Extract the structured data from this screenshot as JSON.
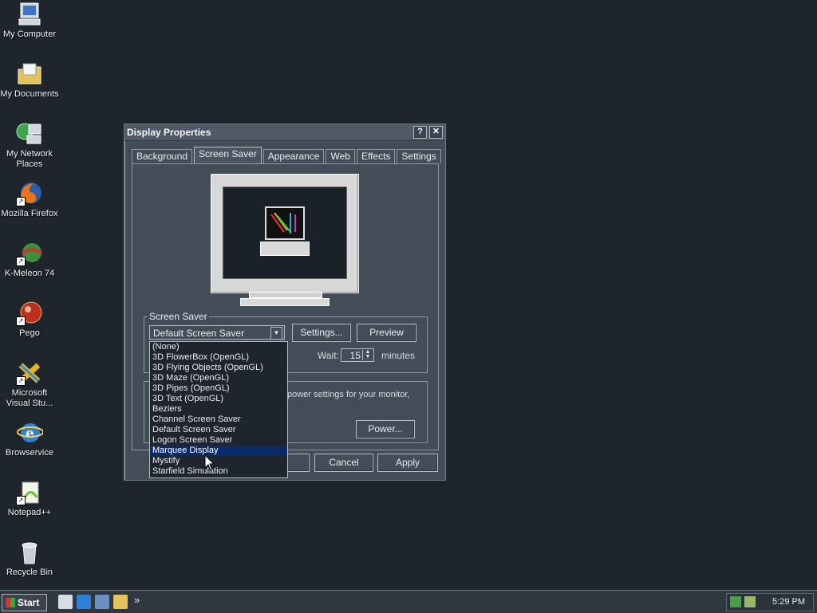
{
  "desktop_icons": [
    {
      "label": "My Computer",
      "icon": "computer-icon"
    },
    {
      "label": "My Documents",
      "icon": "documents-folder-icon"
    },
    {
      "label": "My Network Places",
      "icon": "network-places-icon"
    },
    {
      "label": "Mozilla Firefox",
      "icon": "firefox-icon"
    },
    {
      "label": "K-Meleon 74",
      "icon": "kmeleon-icon"
    },
    {
      "label": "Pego",
      "icon": "pego-icon"
    },
    {
      "label": "Microsoft Visual Stu...",
      "icon": "visual-studio-icon"
    },
    {
      "label": "Browservice",
      "icon": "browservice-icon"
    },
    {
      "label": "Notepad++",
      "icon": "notepadpp-icon"
    },
    {
      "label": "Recycle Bin",
      "icon": "recycle-bin-icon"
    }
  ],
  "dialog": {
    "title": "Display Properties",
    "help_glyph": "?",
    "close_glyph": "✕",
    "tabs": [
      "Background",
      "Screen Saver",
      "Appearance",
      "Web",
      "Effects",
      "Settings"
    ],
    "active_tab": "Screen Saver"
  },
  "screensaver": {
    "group_label": "Screen Saver",
    "selected": "Default Screen Saver",
    "settings_label": "Settings...",
    "preview_label": "Preview",
    "wait_label": "Wait:",
    "wait_value": "15",
    "minutes_label": "minutes",
    "options": [
      "(None)",
      "3D FlowerBox (OpenGL)",
      "3D Flying Objects (OpenGL)",
      "3D Maze (OpenGL)",
      "3D Pipes (OpenGL)",
      "3D Text (OpenGL)",
      "Beziers",
      "Channel Screen Saver",
      "Default Screen Saver",
      "Logon Screen Saver",
      "Marquee Display",
      "Mystify",
      "Starfield Simulation"
    ],
    "highlighted": "Marquee Display"
  },
  "power": {
    "text": "power settings for your monitor,",
    "button_label": "Power..."
  },
  "footer": {
    "cancel_label": "Cancel",
    "apply_label": "Apply"
  },
  "taskbar": {
    "start_label": "Start",
    "overflow_glyph": "»",
    "clock": "5:29 PM"
  },
  "colors": {
    "desktop": "#1f252d",
    "selection": "#0b2a6c"
  }
}
